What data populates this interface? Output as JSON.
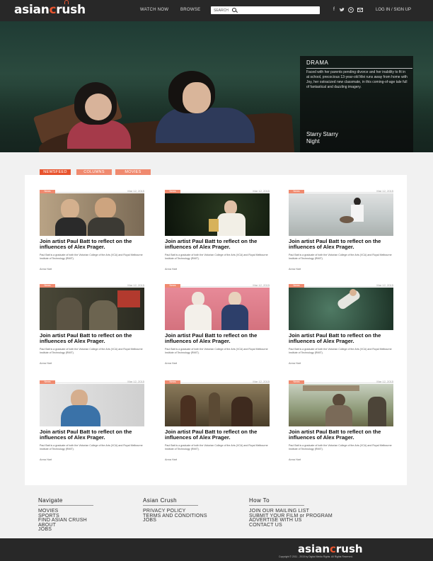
{
  "header": {
    "logo_text_1": "asian",
    "logo_text_2": "c",
    "logo_text_3": "rush",
    "nav": [
      "WATCH NOW",
      "BROWSE"
    ],
    "search_placeholder": "SEARCH",
    "login": "LOG IN / SIGN UP",
    "social_icons": [
      "facebook-icon",
      "twitter-icon",
      "pinterest-icon",
      "email-icon"
    ]
  },
  "hero": {
    "genre": "DRAMA",
    "description": "Faced with her parents pending divorce and her inability to fit in at school, precocious 13-year-old Mei runs away from home with Joy, her ostracized new classmate, in this coming-of-age tale full of fantastical and dazzling imagery.",
    "subtitle": "Starry Starry Night"
  },
  "tabs": [
    "NEWSFEED",
    "COLUMNS",
    "MOVIES"
  ],
  "articles": [
    {
      "badge": "News",
      "date": "Mar 12, 2015",
      "title": "Join artist Paul Batt to reflect on the influences of Alex Prager.",
      "desc": "Paul Batt is a graduate of both the Victorian College of the Arts (VCA) and Royal Melbourne Institute of Technology (RMIT).",
      "author": "Anna Hart"
    },
    {
      "badge": "News",
      "date": "Mar 12, 2015",
      "title": "Join artist Paul Batt to reflect on the influences of Alex Prager.",
      "desc": "Paul Batt is a graduate of both the Victorian College of the Arts (VCA) and Royal Melbourne Institute of Technology (RMIT).",
      "author": "Anna Hart"
    },
    {
      "badge": "News",
      "date": "Mar 12, 2015",
      "title": "Join artist Paul Batt to reflect on the influences of Alex Prager.",
      "desc": "Paul Batt is a graduate of both the Victorian College of the Arts (VCA) and Royal Melbourne Institute of Technology (RMIT).",
      "author": "Anna Hart"
    },
    {
      "badge": "News",
      "date": "Mar 12, 2015",
      "title": "Join artist Paul Batt to reflect on the influences of Alex Prager.",
      "desc": "Paul Batt is a graduate of both the Victorian College of the Arts (VCA) and Royal Melbourne Institute of Technology (RMIT).",
      "author": "Anna Hart"
    },
    {
      "badge": "News",
      "date": "Mar 12, 2015",
      "title": "Join artist Paul Batt to reflect on the influences of Alex Prager.",
      "desc": "Paul Batt is a graduate of both the Victorian College of the Arts (VCA) and Royal Melbourne Institute of Technology (RMIT).",
      "author": "Anna Hart"
    },
    {
      "badge": "News",
      "date": "Mar 12, 2015",
      "title": "Join artist Paul Batt to reflect on the influences of Alex Prager.",
      "desc": "Paul Batt is a graduate of both the Victorian College of the Arts (VCA) and Royal Melbourne Institute of Technology (RMIT).",
      "author": "Anna Hart"
    },
    {
      "badge": "News",
      "date": "Mar 12, 2015",
      "title": "Join artist Paul Batt to reflect on the influences of Alex Prager.",
      "desc": "Paul Batt is a graduate of both the Victorian College of the Arts (VCA) and Royal Melbourne Institute of Technology (RMIT).",
      "author": "Anna Hart"
    },
    {
      "badge": "News",
      "date": "Mar 12, 2015",
      "title": "Join artist Paul Batt to reflect on the influences of Alex Prager.",
      "desc": "Paul Batt is a graduate of both the Victorian College of the Arts (VCA) and Royal Melbourne Institute of Technology (RMIT).",
      "author": "Anna Hart"
    },
    {
      "badge": "News",
      "date": "Mar 12, 2015",
      "title": "Join artist Paul Batt to reflect on the influences of Alex Prager.",
      "desc": "Paul Batt is a graduate of both the Victorian College of the Arts (VCA) and Royal Melbourne Institute of Technology (RMIT).",
      "author": "Anna Hart"
    }
  ],
  "footer": {
    "columns": [
      {
        "heading": "Navigate",
        "links": [
          "MOVIES",
          "SPORTS",
          "FIND ASIAN CRUSH",
          "ABOUT",
          "JOBS"
        ]
      },
      {
        "heading": "Asian Crush",
        "links": [
          "PRIVACY POLICY",
          "TERMS AND CONDITIONS",
          "JOBS"
        ]
      },
      {
        "heading": "How To",
        "links": [
          "JOIN OUR MAILING LIST",
          "SUBMIT YOUR FILM or PROGRAM",
          "ADVERTISE WITH US",
          "CONTACT US"
        ]
      }
    ],
    "copyright": "Copyright © 2011 - 2015 by Digital Media Rights. All Rights Reserved."
  },
  "colors": {
    "accent": "#e8542e",
    "tab_inactive": "#f08a6f",
    "bar": "#282828"
  }
}
